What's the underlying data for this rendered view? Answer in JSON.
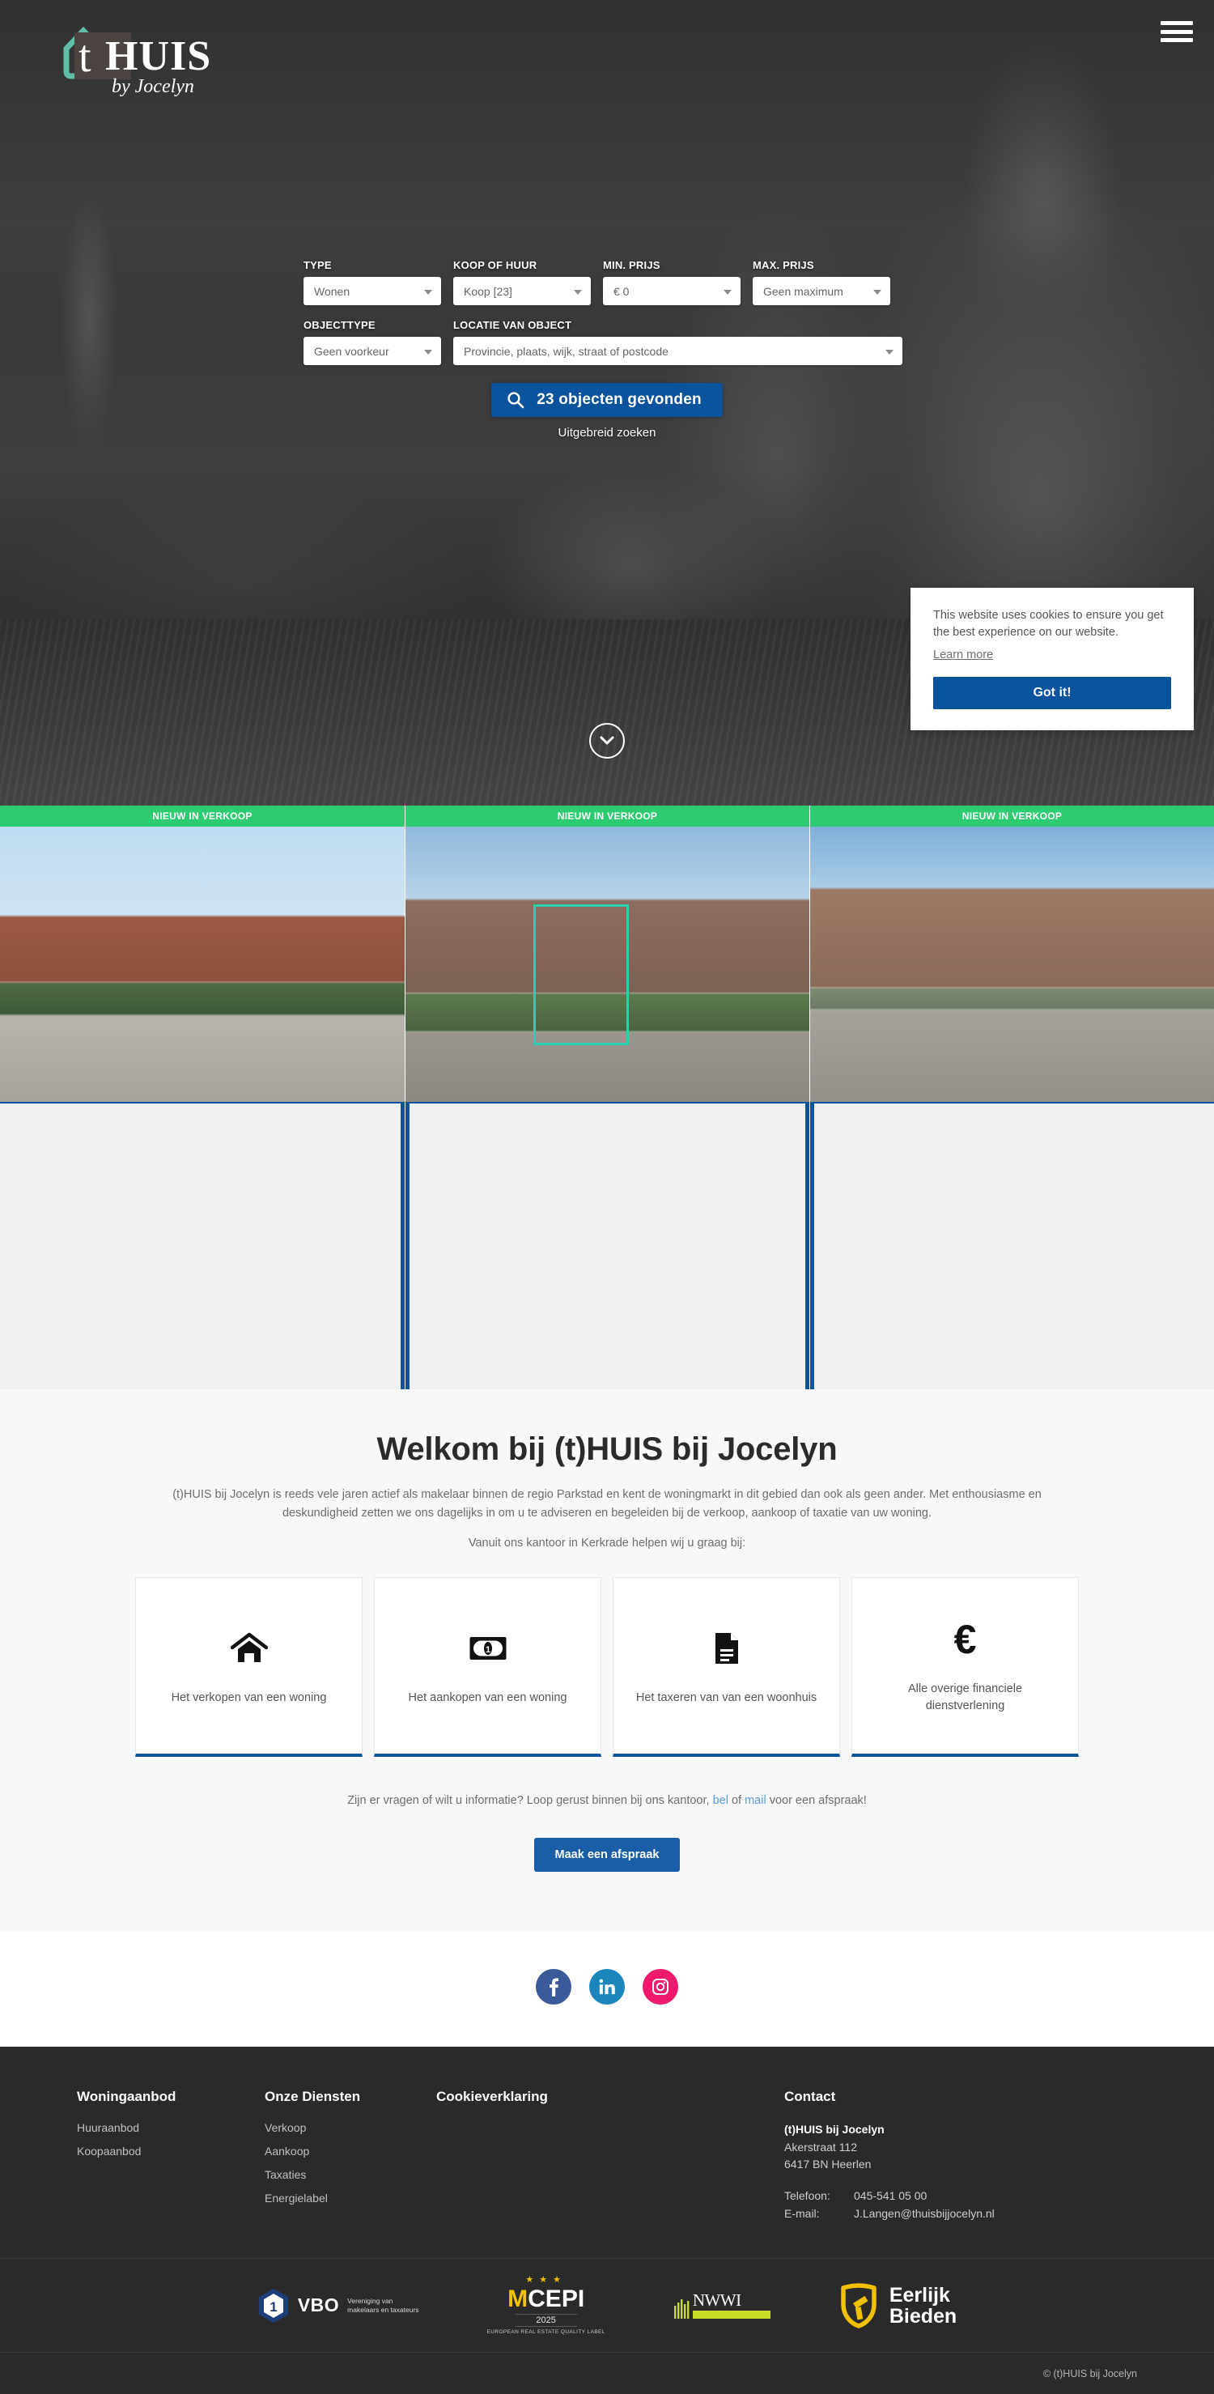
{
  "brand": {
    "name": "(t)HUIS",
    "tagline": "by Jocelyn",
    "letter": "t"
  },
  "header": {
    "menu_icon": "hamburger-menu-icon"
  },
  "search": {
    "fields": [
      {
        "label": "TYPE",
        "value": "Wonen",
        "name": "type"
      },
      {
        "label": "KOOP OF HUUR",
        "value": "Koop [23]",
        "name": "koop-of-huur"
      },
      {
        "label": "MIN. PRIJS",
        "value": "€ 0",
        "name": "min-prijs"
      },
      {
        "label": "MAX. PRIJS",
        "value": "Geen maximum",
        "name": "max-prijs"
      },
      {
        "label": "OBJECTTYPE",
        "value": "Geen voorkeur",
        "name": "objecttype"
      },
      {
        "label": "LOCATIE VAN OBJECT",
        "value": "Provincie, plaats, wijk, straat of postcode",
        "name": "locatie"
      }
    ],
    "submit_label": "23 objecten gevonden",
    "advanced_label": "Uitgebreid zoeken",
    "search_icon": "magnifier-icon",
    "scroll_icon": "chevron-down-icon"
  },
  "cookie": {
    "text": "This website uses cookies to ensure you get the best experience on our website.",
    "learn_more": "Learn more",
    "accept_label": "Got it!"
  },
  "listings": {
    "badge": "NIEUW IN VERKOOP",
    "items": [
      {
        "badge": "NIEUW IN VERKOOP"
      },
      {
        "badge": "NIEUW IN VERKOOP"
      },
      {
        "badge": "NIEUW IN VERKOOP"
      }
    ]
  },
  "welcome": {
    "heading": "Welkom bij (t)HUIS bij Jocelyn",
    "intro": "(t)HUIS bij Jocelyn is reeds vele jaren actief als makelaar binnen de regio Parkstad en kent de woningmarkt in dit gebied dan ook als geen ander. Met enthousiasme en deskundigheid zetten we ons dagelijks in om u te adviseren en begeleiden bij de verkoop, aankoop of taxatie van uw woning.",
    "subline": "Vanuit ons kantoor in Kerkrade helpen wij u graag bij:",
    "cards": [
      {
        "icon": "house-icon",
        "label": "Het verkopen van een woning"
      },
      {
        "icon": "banknote-icon",
        "label": "Het aankopen van een woning"
      },
      {
        "icon": "document-icon",
        "label": "Het taxeren van van een woonhuis"
      },
      {
        "icon": "euro-icon",
        "label": "Alle overige financiele dienstverlening"
      }
    ],
    "question_prefix": "Zijn er vragen of wilt u informatie? Loop gerust binnen bij ons kantoor, ",
    "link_bel": "bel",
    "question_mid": " of ",
    "link_mail": "mail",
    "question_suffix": " voor een afspraak!",
    "appointment_label": "Maak een afspraak"
  },
  "social": [
    {
      "name": "facebook-icon",
      "label": "Facebook"
    },
    {
      "name": "linkedin-icon",
      "label": "LinkedIn"
    },
    {
      "name": "instagram-icon",
      "label": "Instagram"
    }
  ],
  "footer": {
    "columns": [
      {
        "title": "Woningaanbod",
        "links": [
          "Huuraanbod",
          "Koopaanbod"
        ]
      },
      {
        "title": "Onze Diensten",
        "links": [
          "Verkoop",
          "Aankoop",
          "Taxaties",
          "Energielabel"
        ]
      },
      {
        "title": "Cookieverklaring",
        "links": []
      }
    ],
    "contact": {
      "title": "Contact",
      "company": "(t)HUIS bij Jocelyn",
      "street": "Akerstraat 112",
      "city": "6417 BN Heerlen",
      "phone_label": "Telefoon:",
      "phone_value": "045-541 05 00",
      "email_label": "E-mail:",
      "email_value": "J.Langen@thuisbijjocelyn.nl"
    },
    "partners": [
      {
        "name": "vbo-logo",
        "main": "VBO",
        "sub1": "Vereniging van",
        "sub2": "makelaars en taxateurs"
      },
      {
        "name": "cepi-logo",
        "main": "CEPI",
        "prefix": "M",
        "year": "2025",
        "sub": "EUROPEAN REAL ESTATE QUALITY LABEL"
      },
      {
        "name": "nwwi-logo",
        "main": "NWWI"
      },
      {
        "name": "eerlijk-bieden-logo",
        "line1": "Eerlijk",
        "line2": "Bieden"
      }
    ],
    "copyright": "© (t)HUIS bij Jocelyn"
  },
  "colors": {
    "primary_blue": "#0b539c",
    "badge_green": "#2ecc71",
    "logo_teal": "#5fbfa8",
    "footer_bg": "#2a2a2a",
    "gold": "#f2c200"
  }
}
